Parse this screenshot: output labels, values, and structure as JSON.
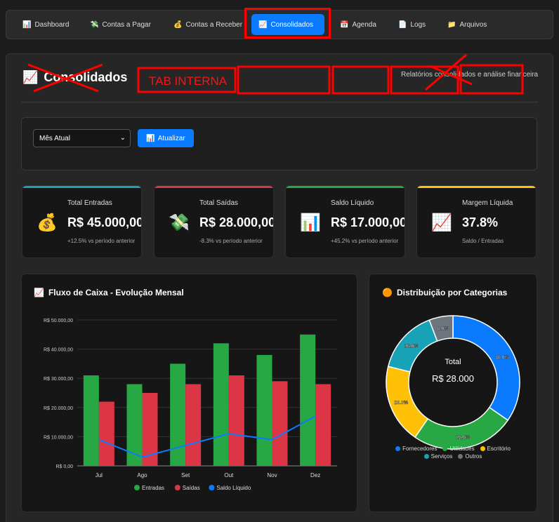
{
  "nav": {
    "items": [
      {
        "icon": "📊",
        "label": "Dashboard"
      },
      {
        "icon": "💸",
        "label": "Contas a Pagar"
      },
      {
        "icon": "💰",
        "label": "Contas a Receber"
      },
      {
        "icon": "📈",
        "label": "Consolidados"
      },
      {
        "icon": "📅",
        "label": "Agenda"
      },
      {
        "icon": "📄",
        "label": "Logs"
      },
      {
        "icon": "📁",
        "label": "Arquivos"
      }
    ],
    "active": "Consolidados"
  },
  "page": {
    "icon": "📈",
    "title": "Consolidados",
    "subtitle": "Relatórios consolidados e análise financeira",
    "annotation": "TAB INTERNA"
  },
  "filters": {
    "period": "Mês Atual",
    "update_icon": "📊",
    "update_label": "Atualizar"
  },
  "kpis": [
    {
      "label": "Total Entradas",
      "value": "R$ 45.000,00",
      "note": "+12.5% vs período anterior",
      "icon": "💰",
      "accent": "#17a2b8"
    },
    {
      "label": "Total Saídas",
      "value": "R$ 28.000,00",
      "note": "-8.3% vs período anterior",
      "icon": "💸",
      "accent": "#dc3545"
    },
    {
      "label": "Saldo Líquido",
      "value": "R$ 17.000,00",
      "note": "+45.2% vs período anterior",
      "icon": "📊",
      "accent": "#28a745"
    },
    {
      "label": "Margem Líquida",
      "value": "37.8%",
      "note": "Saldo / Entradas",
      "icon": "📈",
      "accent": "#ffc107"
    }
  ],
  "cashflow": {
    "icon": "📈",
    "title": "Fluxo de Caixa - Evolução Mensal"
  },
  "distribution": {
    "icon": "🟠",
    "title": "Distribuição por Categorias",
    "center_label": "Total",
    "center_value": "R$ 28.000"
  },
  "chart_data": [
    {
      "type": "bar",
      "title": "Fluxo de Caixa - Evolução Mensal",
      "categories": [
        "Jul",
        "Ago",
        "Set",
        "Out",
        "Nov",
        "Dez"
      ],
      "ylim": [
        0,
        50000
      ],
      "yticks": [
        "R$ 0,00",
        "R$ 10.000,00",
        "R$ 20.000,00",
        "R$ 30.000,00",
        "R$ 40.000,00",
        "R$ 50.000,00"
      ],
      "series": [
        {
          "name": "Entradas",
          "kind": "bar",
          "color": "#28a745",
          "values": [
            31000,
            28000,
            35000,
            42000,
            38000,
            45000
          ]
        },
        {
          "name": "Saídas",
          "kind": "bar",
          "color": "#dc3545",
          "values": [
            22000,
            25000,
            28000,
            31000,
            29000,
            28000
          ]
        },
        {
          "name": "Saldo Líquido",
          "kind": "line",
          "color": "#0a7bff",
          "values": [
            9000,
            3000,
            7000,
            11000,
            9000,
            17000
          ]
        }
      ],
      "legend": "bottom",
      "grid": true
    },
    {
      "type": "pie",
      "title": "Distribuição por Categorias",
      "slices": [
        {
          "name": "Fornecedores",
          "value": 36.0,
          "label": "36.0%",
          "color": "#0a7bff"
        },
        {
          "name": "Utilidades",
          "value": 26.0,
          "label": "26.0%",
          "color": "#28a745"
        },
        {
          "name": "Escritório",
          "value": 20.0,
          "label": "20.0%",
          "color": "#ffc107"
        },
        {
          "name": "Serviços",
          "value": 16.0,
          "label": "16.0%",
          "color": "#17a2b8"
        },
        {
          "name": "Outros",
          "value": 6.0,
          "label": "6.0%",
          "color": "#6c757d"
        }
      ],
      "legend": "bottom"
    }
  ]
}
